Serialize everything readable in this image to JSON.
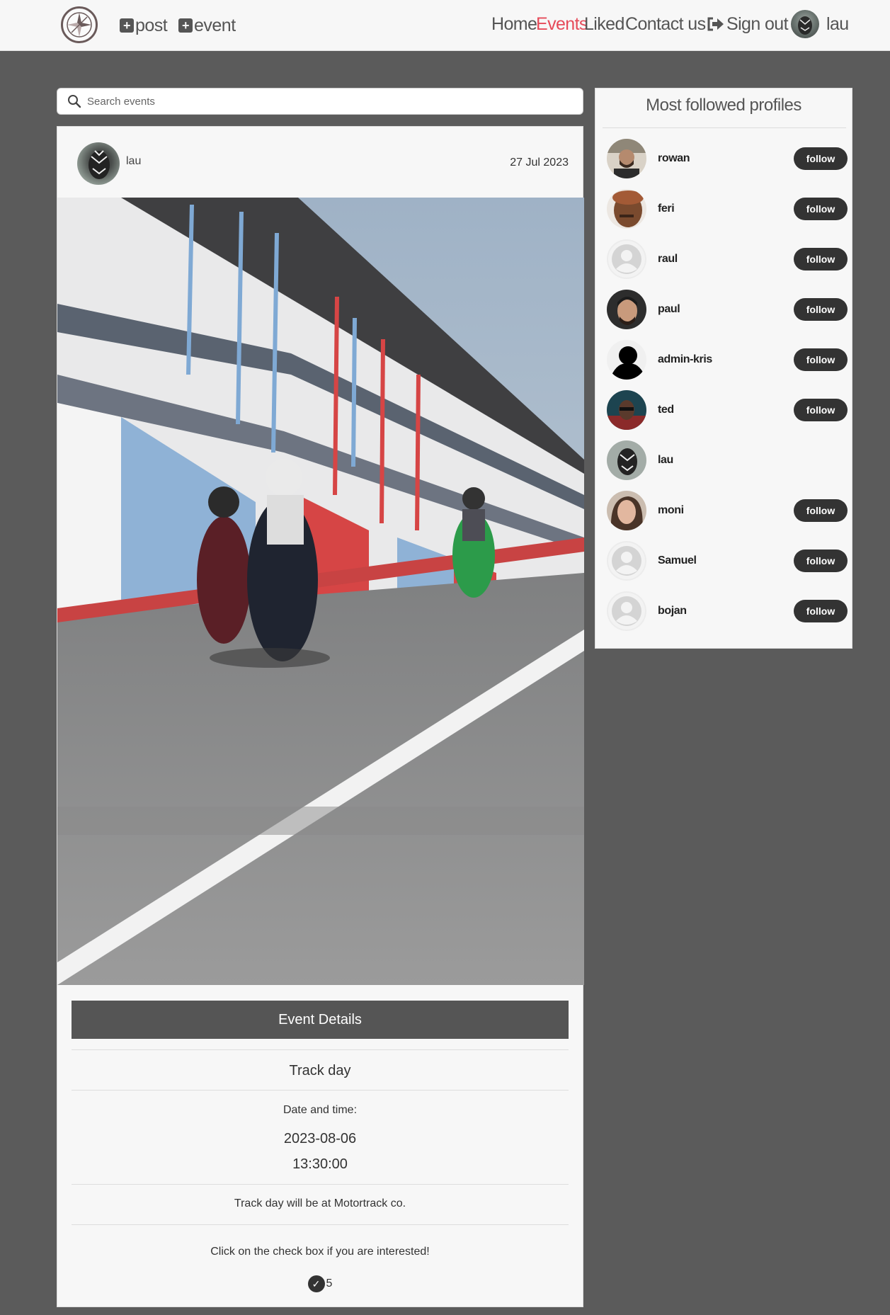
{
  "nav": {
    "add_post": "post",
    "add_event": "event",
    "home": "Home",
    "events": "Events",
    "liked": "Liked",
    "contact": "Contact us",
    "signout": "Sign out",
    "username": "lau",
    "active_color": "#e64b5a"
  },
  "search": {
    "placeholder": "Search events"
  },
  "post": {
    "author": "lau",
    "date": "27 Jul 2023",
    "details_button": "Event Details",
    "title": "Track day",
    "datetime_label": "Date and time:",
    "date_value": "2023-08-06",
    "time_value": "13:30:00",
    "description": "Track day will be at Motortrack co.",
    "interest_prompt": "Click on the check box if you are interested!",
    "interest_count": "5"
  },
  "sidebar": {
    "title": "Most followed profiles",
    "follow_label": "follow",
    "profiles": [
      {
        "name": "rowan",
        "has_follow": true,
        "avatar": "photo"
      },
      {
        "name": "feri",
        "has_follow": true,
        "avatar": "photo"
      },
      {
        "name": "raul",
        "has_follow": true,
        "avatar": "default"
      },
      {
        "name": "paul",
        "has_follow": true,
        "avatar": "photo"
      },
      {
        "name": "admin-kris",
        "has_follow": true,
        "avatar": "silhouette"
      },
      {
        "name": "ted",
        "has_follow": true,
        "avatar": "photo"
      },
      {
        "name": "lau",
        "has_follow": false,
        "avatar": "photo"
      },
      {
        "name": "moni",
        "has_follow": true,
        "avatar": "photo"
      },
      {
        "name": "Samuel",
        "has_follow": true,
        "avatar": "default"
      },
      {
        "name": "bojan",
        "has_follow": true,
        "avatar": "default"
      }
    ]
  }
}
